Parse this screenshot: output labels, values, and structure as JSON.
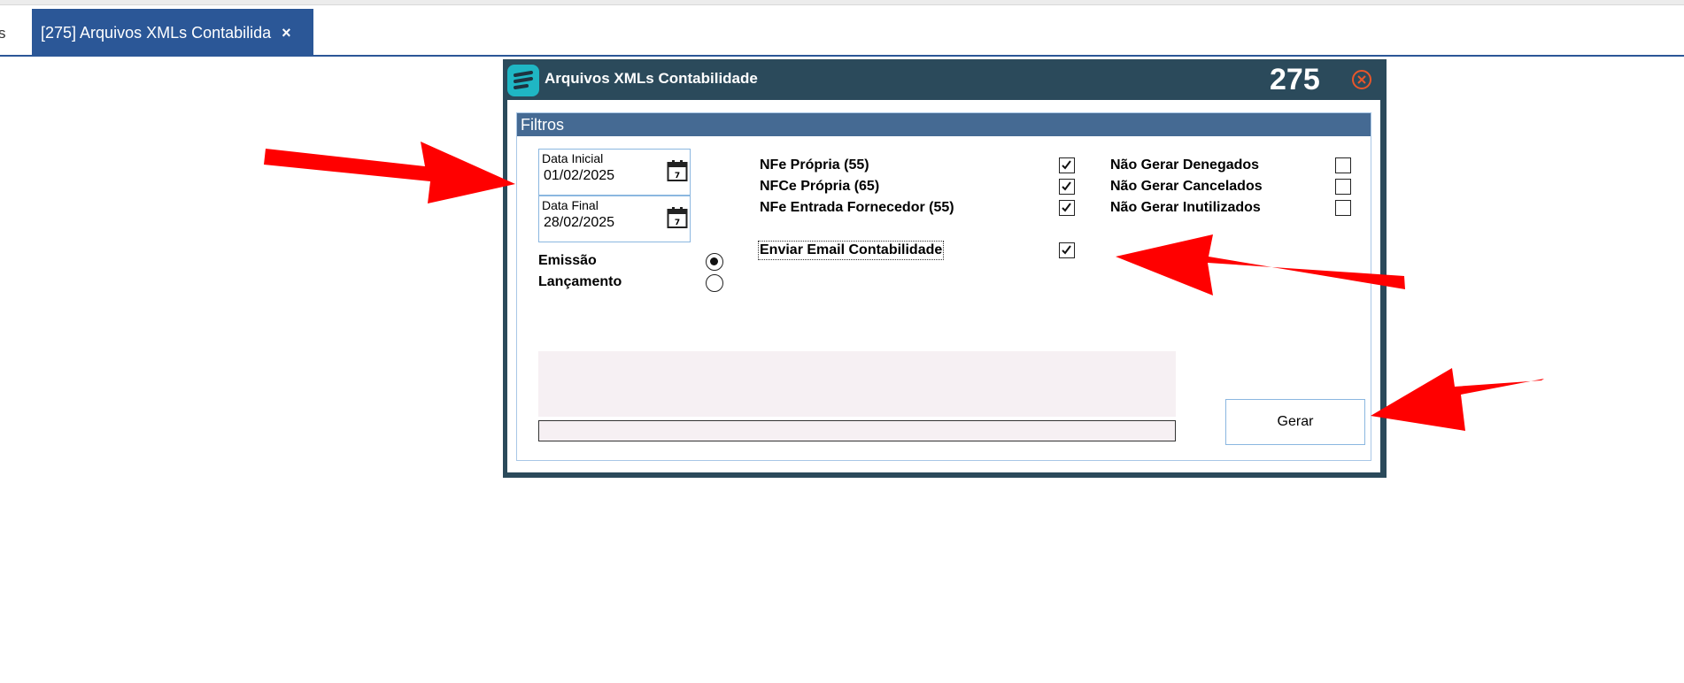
{
  "tabs": {
    "previous_partial": "s",
    "active_label": "[275] Arquivos XMLs Contabilida",
    "close_glyph": "×"
  },
  "dialog": {
    "title": "Arquivos XMLs Contabilidade",
    "code": "275",
    "group_title": "Filtros",
    "data_inicial": {
      "label": "Data Inicial",
      "value": "01/02/2025"
    },
    "data_final": {
      "label": "Data Final",
      "value": "28/02/2025"
    },
    "radio_options": [
      {
        "label": "Emissão",
        "selected": true
      },
      {
        "label": "Lançamento",
        "selected": false
      }
    ],
    "checks_left": [
      {
        "label": "NFe Própria (55)",
        "checked": true
      },
      {
        "label": "NFCe Própria (65)",
        "checked": true
      },
      {
        "label": "NFe Entrada Fornecedor (55)",
        "checked": true
      }
    ],
    "checks_right": [
      {
        "label": "Não Gerar Denegados",
        "checked": false
      },
      {
        "label": "Não Gerar Cancelados",
        "checked": false
      },
      {
        "label": "Não Gerar Inutilizados",
        "checked": false
      }
    ],
    "email_check": {
      "label": "Enviar Email Contabilidade",
      "checked": true
    },
    "gerar_label": "Gerar"
  },
  "colors": {
    "tab_active": "#2b5797",
    "dialog_frame": "#2b4a5b",
    "group_header": "#456a93",
    "annotation_arrow": "#ff0000"
  }
}
